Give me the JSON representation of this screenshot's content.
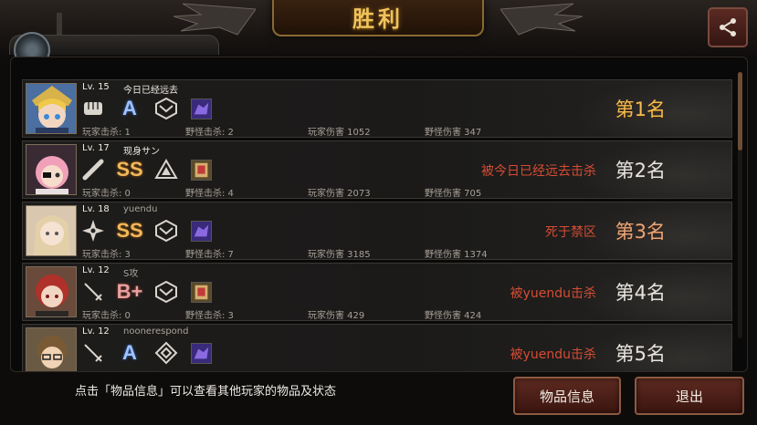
{
  "header": {
    "title": "胜利",
    "share_icon": "share-icon"
  },
  "players": [
    {
      "level": "Lv. 15",
      "name": "今日已经远去",
      "weapon_icon": "fist-icon",
      "grade": "A",
      "stat_kill_player": "玩家击杀: 1",
      "stat_kill_monster": "野怪击杀: 2",
      "stat_dmg_player": "玩家伤害 1052",
      "stat_dmg_monster": "野怪伤害 347",
      "status": "",
      "rank": "第1名"
    },
    {
      "level": "Lv. 17",
      "name": "现身サン",
      "weapon_icon": "bat-icon",
      "grade": "SS",
      "stat_kill_player": "玩家击杀: 0",
      "stat_kill_monster": "野怪击杀: 4",
      "stat_dmg_player": "玩家伤害 2073",
      "stat_dmg_monster": "野怪伤害 705",
      "status": "被今日已经远去击杀",
      "rank": "第2名"
    },
    {
      "level": "Lv. 18",
      "name": "yuendu",
      "weapon_icon": "shuriken-icon",
      "grade": "SS",
      "stat_kill_player": "玩家击杀: 3",
      "stat_kill_monster": "野怪击杀: 7",
      "stat_dmg_player": "玩家伤害 3185",
      "stat_dmg_monster": "野怪伤害 1374",
      "status": "死于禁区",
      "rank": "第3名"
    },
    {
      "level": "Lv. 12",
      "name": "S攻",
      "weapon_icon": "rapier-icon",
      "grade": "B+",
      "stat_kill_player": "玩家击杀: 0",
      "stat_kill_monster": "野怪击杀: 3",
      "stat_dmg_player": "玩家伤害 429",
      "stat_dmg_monster": "野怪伤害 424",
      "status": "被yuendu击杀",
      "rank": "第4名"
    },
    {
      "level": "Lv. 12",
      "name": "noonerespond",
      "weapon_icon": "rapier-icon",
      "grade": "A",
      "stat_kill_player": "",
      "stat_kill_monster": "",
      "stat_dmg_player": "",
      "stat_dmg_monster": "",
      "status": "被yuendu击杀",
      "rank": "第5名"
    }
  ],
  "footer": {
    "hint": "点击「物品信息」可以查看其他玩家的物品及状态",
    "items_button": "物品信息",
    "exit_button": "退出"
  },
  "colors": {
    "gold": "#f3bb52",
    "status_red": "#d64c33",
    "button_bg": "#4a1f18"
  }
}
